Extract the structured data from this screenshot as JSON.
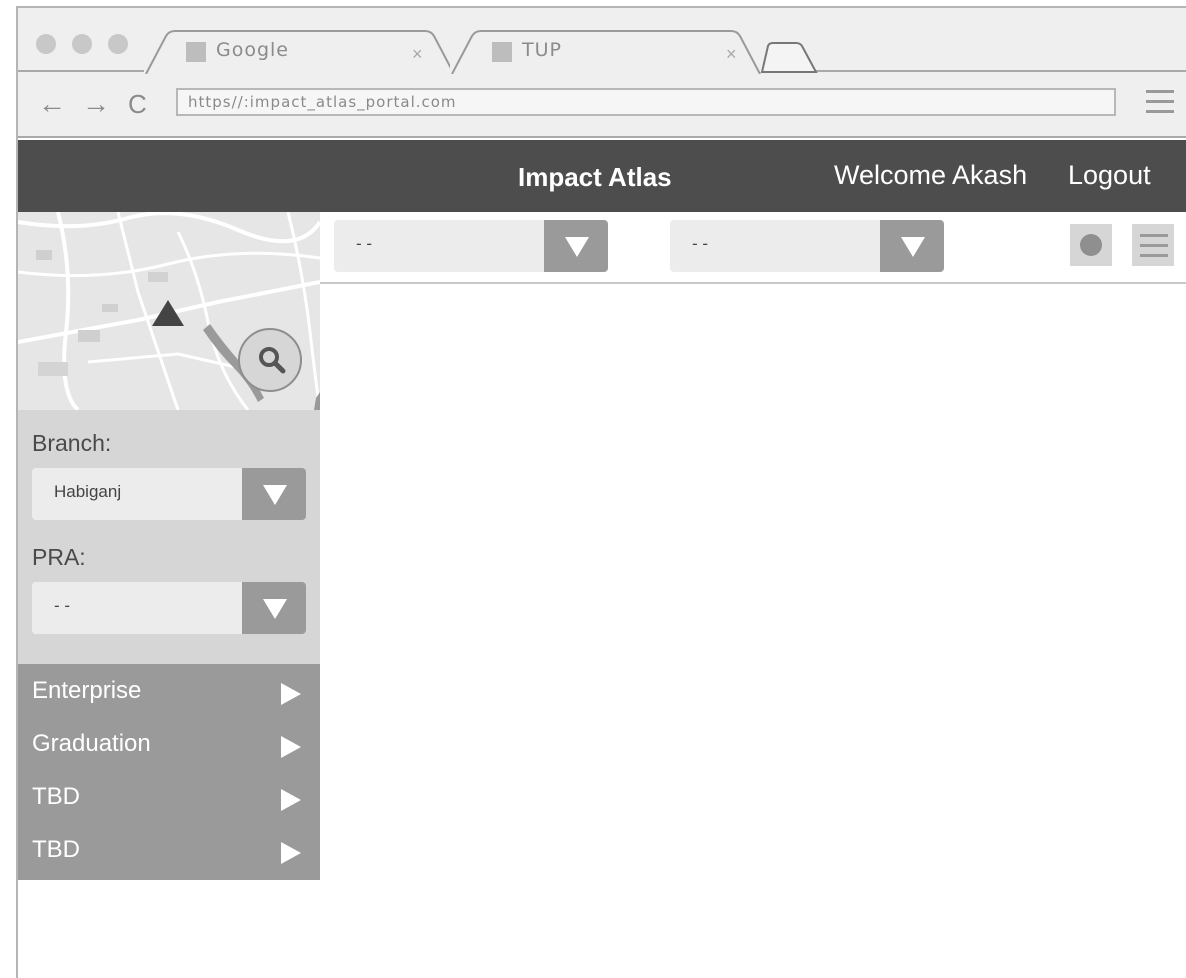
{
  "browser": {
    "tabs": [
      {
        "label": "Google",
        "close": "×"
      },
      {
        "label": "TUP",
        "close": "×"
      }
    ],
    "url": "https//:impact_atlas_portal.com",
    "nav": {
      "back": "←",
      "forward": "→",
      "reload": "C"
    }
  },
  "header": {
    "title": "Impact Atlas",
    "welcome": "Welcome Akash",
    "logout": "Logout"
  },
  "sidebar": {
    "branch_label": "Branch:",
    "branch_value": "Habiganj",
    "pra_label": "PRA:",
    "pra_value": "- -",
    "menu": [
      {
        "label": "Enterprise"
      },
      {
        "label": "Graduation"
      },
      {
        "label": "TBD"
      },
      {
        "label": "TBD"
      }
    ]
  },
  "main": {
    "filter1_value": "- -",
    "filter2_value": "- -"
  },
  "colors": {
    "header_bg": "#4d4d4d",
    "menu_bg": "#9a9a9a",
    "filters_bg": "#d6d6d6"
  }
}
